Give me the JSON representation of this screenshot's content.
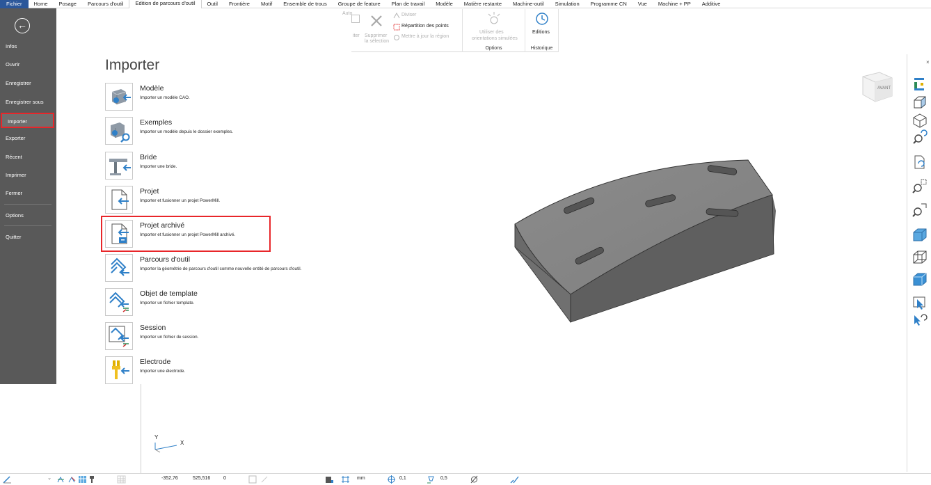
{
  "ribbon_tabs": [
    "Fichier",
    "Home",
    "Posage",
    "Parcours d'outil",
    "Edition de parcours d'outil",
    "Outil",
    "Frontière",
    "Motif",
    "Ensemble de trous",
    "Groupe de feature",
    "Plan de travail",
    "Modèle",
    "Matière restante",
    "Machine-outil",
    "Simulation",
    "Programme CN",
    "Vue",
    "Machine + PP",
    "Additive"
  ],
  "active_tab_index": 4,
  "ribbon": {
    "auto_label": "Auto",
    "partial_left_label": "iter",
    "delete_label_line1": "Supprimer",
    "delete_label_line2": "la sélection",
    "divide_label": "Diviser",
    "point_distribution_label": "Répartition des points",
    "update_region_label": "Mettre à jour la région",
    "use_orientations_line1": "Utiliser des",
    "use_orientations_line2": "orientations simulées",
    "options_group": "Options",
    "editions_label": "Editions",
    "history_group": "Historique"
  },
  "backstage": {
    "items": [
      "Infos",
      "Ouvrir",
      "Enregistrer",
      "Enregistrer sous",
      "Importer",
      "Exporter",
      "Récent",
      "Imprimer",
      "Fermer",
      "Options",
      "Quitter"
    ],
    "selected": "Importer"
  },
  "import_panel": {
    "title": "Importer",
    "items": [
      {
        "name": "Modèle",
        "desc": "Importer un modèle CAO."
      },
      {
        "name": "Exemples",
        "desc": "Importer un modèle depuis le dossier exemples."
      },
      {
        "name": "Bride",
        "desc": "Importer une bride."
      },
      {
        "name": "Projet",
        "desc": "Importer et fusionner un projet PowerMill."
      },
      {
        "name": "Projet archivé",
        "desc": "Importer et fusionner un projet PowerMill archivé."
      },
      {
        "name": "Parcours d'outil",
        "desc": "Importer la géométrie de parcours d'outil comme nouvelle entité de parcours d'outil."
      },
      {
        "name": "Objet de template",
        "desc": "Importer un fichier template."
      },
      {
        "name": "Session",
        "desc": "Importer un fichier de session."
      },
      {
        "name": "Electrode",
        "desc": "Importer une électrode."
      }
    ],
    "highlighted_index": 4
  },
  "viewport": {
    "viewcube_label": "AVANT",
    "axis_y": "Y",
    "axis_x": "X"
  },
  "statusbar": {
    "coord_x": "-352,76",
    "coord_y": "525,516",
    "coord_z": "0",
    "units": "mm",
    "tolerance": "0,1",
    "offset": "0,5"
  },
  "colors": {
    "file_tab": "#2b579a",
    "backstage": "#595959",
    "highlight": "#e8262a",
    "accent_blue": "#2f80c8"
  }
}
